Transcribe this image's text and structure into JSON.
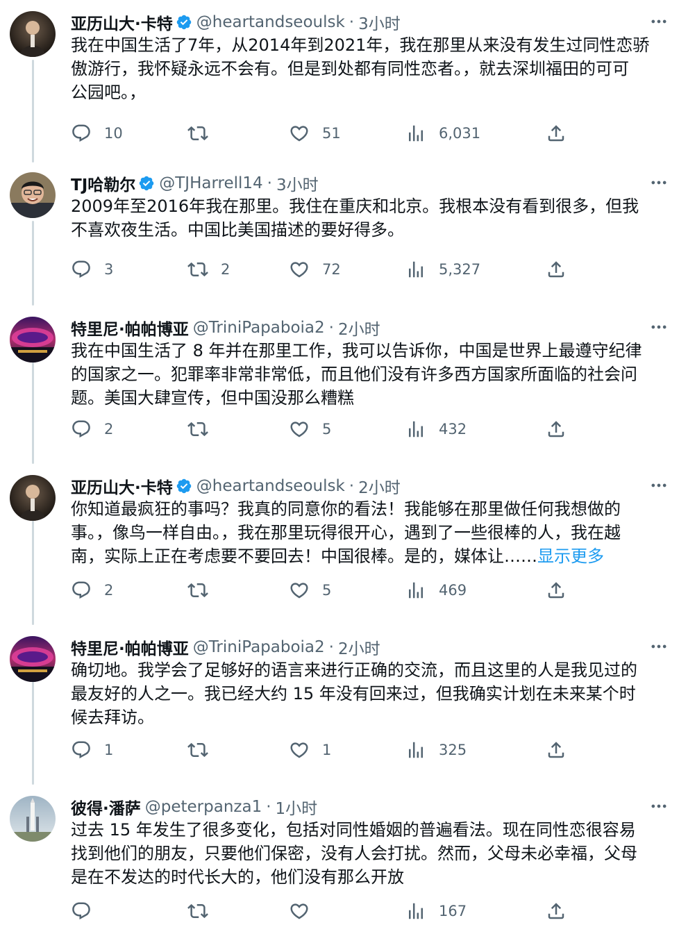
{
  "tweets": [
    {
      "name": "亚历山大·卡特",
      "verified": true,
      "handle": "@heartandseoulsk",
      "time": "3小时",
      "text_lines": [
        "我在中国生活了7年，从2014年到2021年，我在那里从来没有发生过同性恋骄",
        "傲游行，我怀疑永远不会有。但是到处都有同性恋者。，就去深圳福田的可可",
        "公园吧。，"
      ],
      "show_more": "",
      "replies": "10",
      "retweets": "",
      "likes": "51",
      "views": "6,031",
      "avatar": "dark-portrait"
    },
    {
      "name": "TJ哈勒尔",
      "verified": true,
      "handle": "@TJHarrell14",
      "time": "3小时",
      "text_lines": [
        "2009年至2016年我在那里。我住在重庆和北京。我根本没有看到很多，但我",
        "不喜欢夜生活。中国比美国描述的要好得多。"
      ],
      "show_more": "",
      "replies": "3",
      "retweets": "2",
      "likes": "72",
      "views": "5,327",
      "avatar": "smiling-man"
    },
    {
      "name": "特里尼·帕帕博亚",
      "verified": false,
      "handle": "@TriniPapaboia2",
      "time": "2小时",
      "text_lines": [
        "我在中国生活了 8 年并在那里工作，我可以告诉你，中国是世界上最遵守纪律",
        "的国家之一。犯罪率非常非常低，而且他们没有许多西方国家所面临的社会问",
        "题。美国大肆宣传，但中国没那么糟糕"
      ],
      "show_more": "",
      "replies": "2",
      "retweets": "",
      "likes": "5",
      "views": "432",
      "avatar": "stadium"
    },
    {
      "name": "亚历山大·卡特",
      "verified": true,
      "handle": "@heartandseoulsk",
      "time": "2小时",
      "text_lines": [
        "你知道最疯狂的事吗？我真的同意你的看法！我能够在那里做任何我想做的",
        "事。，像鸟一样自由。，我在那里玩得很开心，遇到了一些很棒的人，我在越",
        "南，实际上正在考虑要不要回去！中国很棒。是的，媒体让……"
      ],
      "show_more": "显示更多",
      "replies": "2",
      "retweets": "",
      "likes": "5",
      "views": "469",
      "avatar": "dark-portrait"
    },
    {
      "name": "特里尼·帕帕博亚",
      "verified": false,
      "handle": "@TriniPapaboia2",
      "time": "2小时",
      "text_lines": [
        "确切地。我学会了足够好的语言来进行正确的交流，而且这里的人是我见过的",
        "最友好的人之一。我已经大约 15 年没有回来过，但我确实计划在未来某个时",
        "候去拜访。"
      ],
      "show_more": "",
      "replies": "1",
      "retweets": "",
      "likes": "1",
      "views": "325",
      "avatar": "stadium"
    },
    {
      "name": "彼得·潘萨",
      "verified": false,
      "handle": "@peterpanza1",
      "time": "1小时",
      "text_lines": [
        "过去 15 年发生了很多变化，包括对同性婚姻的普遍看法。现在同性恋很容易",
        "找到他们的朋友，只要他们保密，没有人会打扰。然而，父母未必幸福，父母",
        "是在不发达的时代长大的，他们没有那么开放"
      ],
      "show_more": "",
      "replies": "",
      "retweets": "",
      "likes": "",
      "views": "167",
      "avatar": "rocket-sky"
    }
  ],
  "colors": {
    "accent": "#1d9bf0",
    "secondary_text": "#536471",
    "thread_line": "#cfd9de"
  },
  "icons": {
    "reply": "reply-icon",
    "retweet": "retweet-icon",
    "like": "heart-icon",
    "views": "views-icon",
    "share": "share-icon",
    "more": "more-icon",
    "verified": "verified-badge-icon"
  }
}
